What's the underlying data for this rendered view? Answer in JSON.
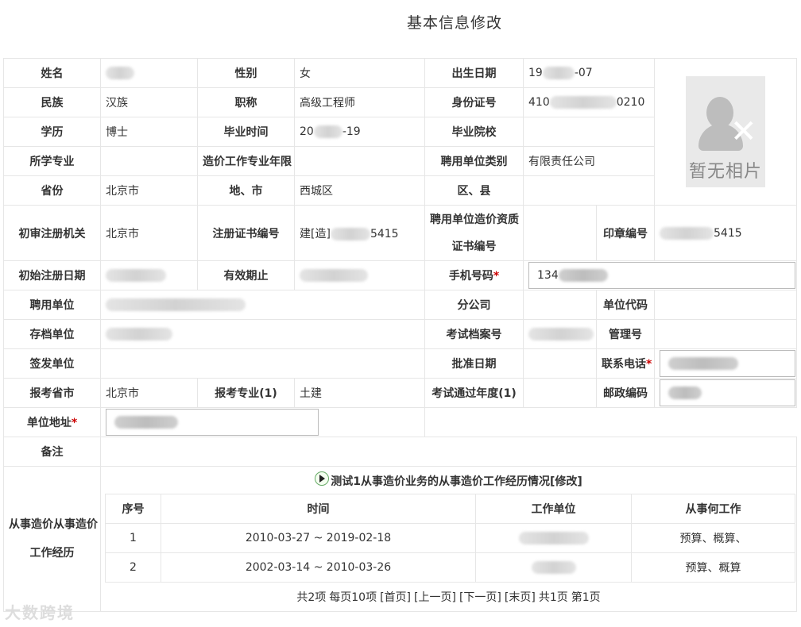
{
  "page_title": "基本信息修改",
  "rows": {
    "name_label": "姓名",
    "gender_label": "性别",
    "gender": "女",
    "birth_label": "出生日期",
    "birth_prefix": "19",
    "birth_suffix": "-07",
    "ethnic_label": "民族",
    "ethnic": "汉族",
    "title_label": "职称",
    "title_value": "高级工程师",
    "id_label": "身份证号",
    "id_prefix": "410",
    "id_suffix": "0210",
    "edu_label": "学历",
    "edu": "博士",
    "grad_time_label": "毕业时间",
    "grad_prefix": "20",
    "grad_suffix": "-19",
    "school_label": "毕业院校",
    "major_label": "所学专业",
    "years_label": "造价工作专业年限",
    "emp_type_label": "聘用单位类别",
    "emp_type": "有限责任公司",
    "province_label": "省份",
    "province": "北京市",
    "city_label": "地、市",
    "city": "西城区",
    "county_label": "区、县",
    "reg_org_label": "初审注册机关",
    "reg_org": "北京市",
    "cert_no_label": "注册证书编号",
    "cert_prefix": "建[造]",
    "cert_suffix": "5415",
    "qual_cert_label_1": "聘用单位造价资质",
    "qual_cert_label_2": "证书编号",
    "seal_label": "印章编号",
    "seal_suffix": "5415",
    "init_reg_date_label": "初始注册日期",
    "valid_until_label": "有效期止",
    "phone_label": "手机号码",
    "phone_prefix": "134",
    "employer_label": "聘用单位",
    "branch_label": "分公司",
    "unit_code_label": "单位代码",
    "archive_unit_label": "存档单位",
    "exam_file_label": "考试档案号",
    "mgmt_no_label": "管理号",
    "issue_unit_label": "签发单位",
    "approve_date_label": "批准日期",
    "contact_phone_label": "联系电话",
    "exam_province_label": "报考省市",
    "exam_province": "北京市",
    "exam_major_label": "报考专业(1)",
    "exam_major": "土建",
    "exam_pass_year_label": "考试通过年度(1)",
    "postcode_label": "邮政编码",
    "unit_address_label": "单位地址",
    "remark_label": "备注",
    "experience_label_1": "从事造价从事造价",
    "experience_label_2": "工作经历",
    "required_mark": "*",
    "photo_text": "暂无相片"
  },
  "experience": {
    "heading": "测试1从事造价业务的从事造价工作经历情况[修改]",
    "columns": [
      "序号",
      "时间",
      "工作单位",
      "从事何工作"
    ],
    "rows": [
      {
        "no": "1",
        "time": "2010-03-27 ~ 2019-02-18",
        "work": "预算、概算、"
      },
      {
        "no": "2",
        "time": "2002-03-14 ~ 2010-03-26",
        "work": "预算、概算"
      }
    ],
    "pager": {
      "total": "共2项",
      "per_page": "每页10项",
      "first": "[首页]",
      "prev": "[上一页]",
      "next": "[下一页]",
      "last": "[末页]",
      "pages": "共1页",
      "current": "第1页"
    }
  },
  "watermark": "大数跨境"
}
